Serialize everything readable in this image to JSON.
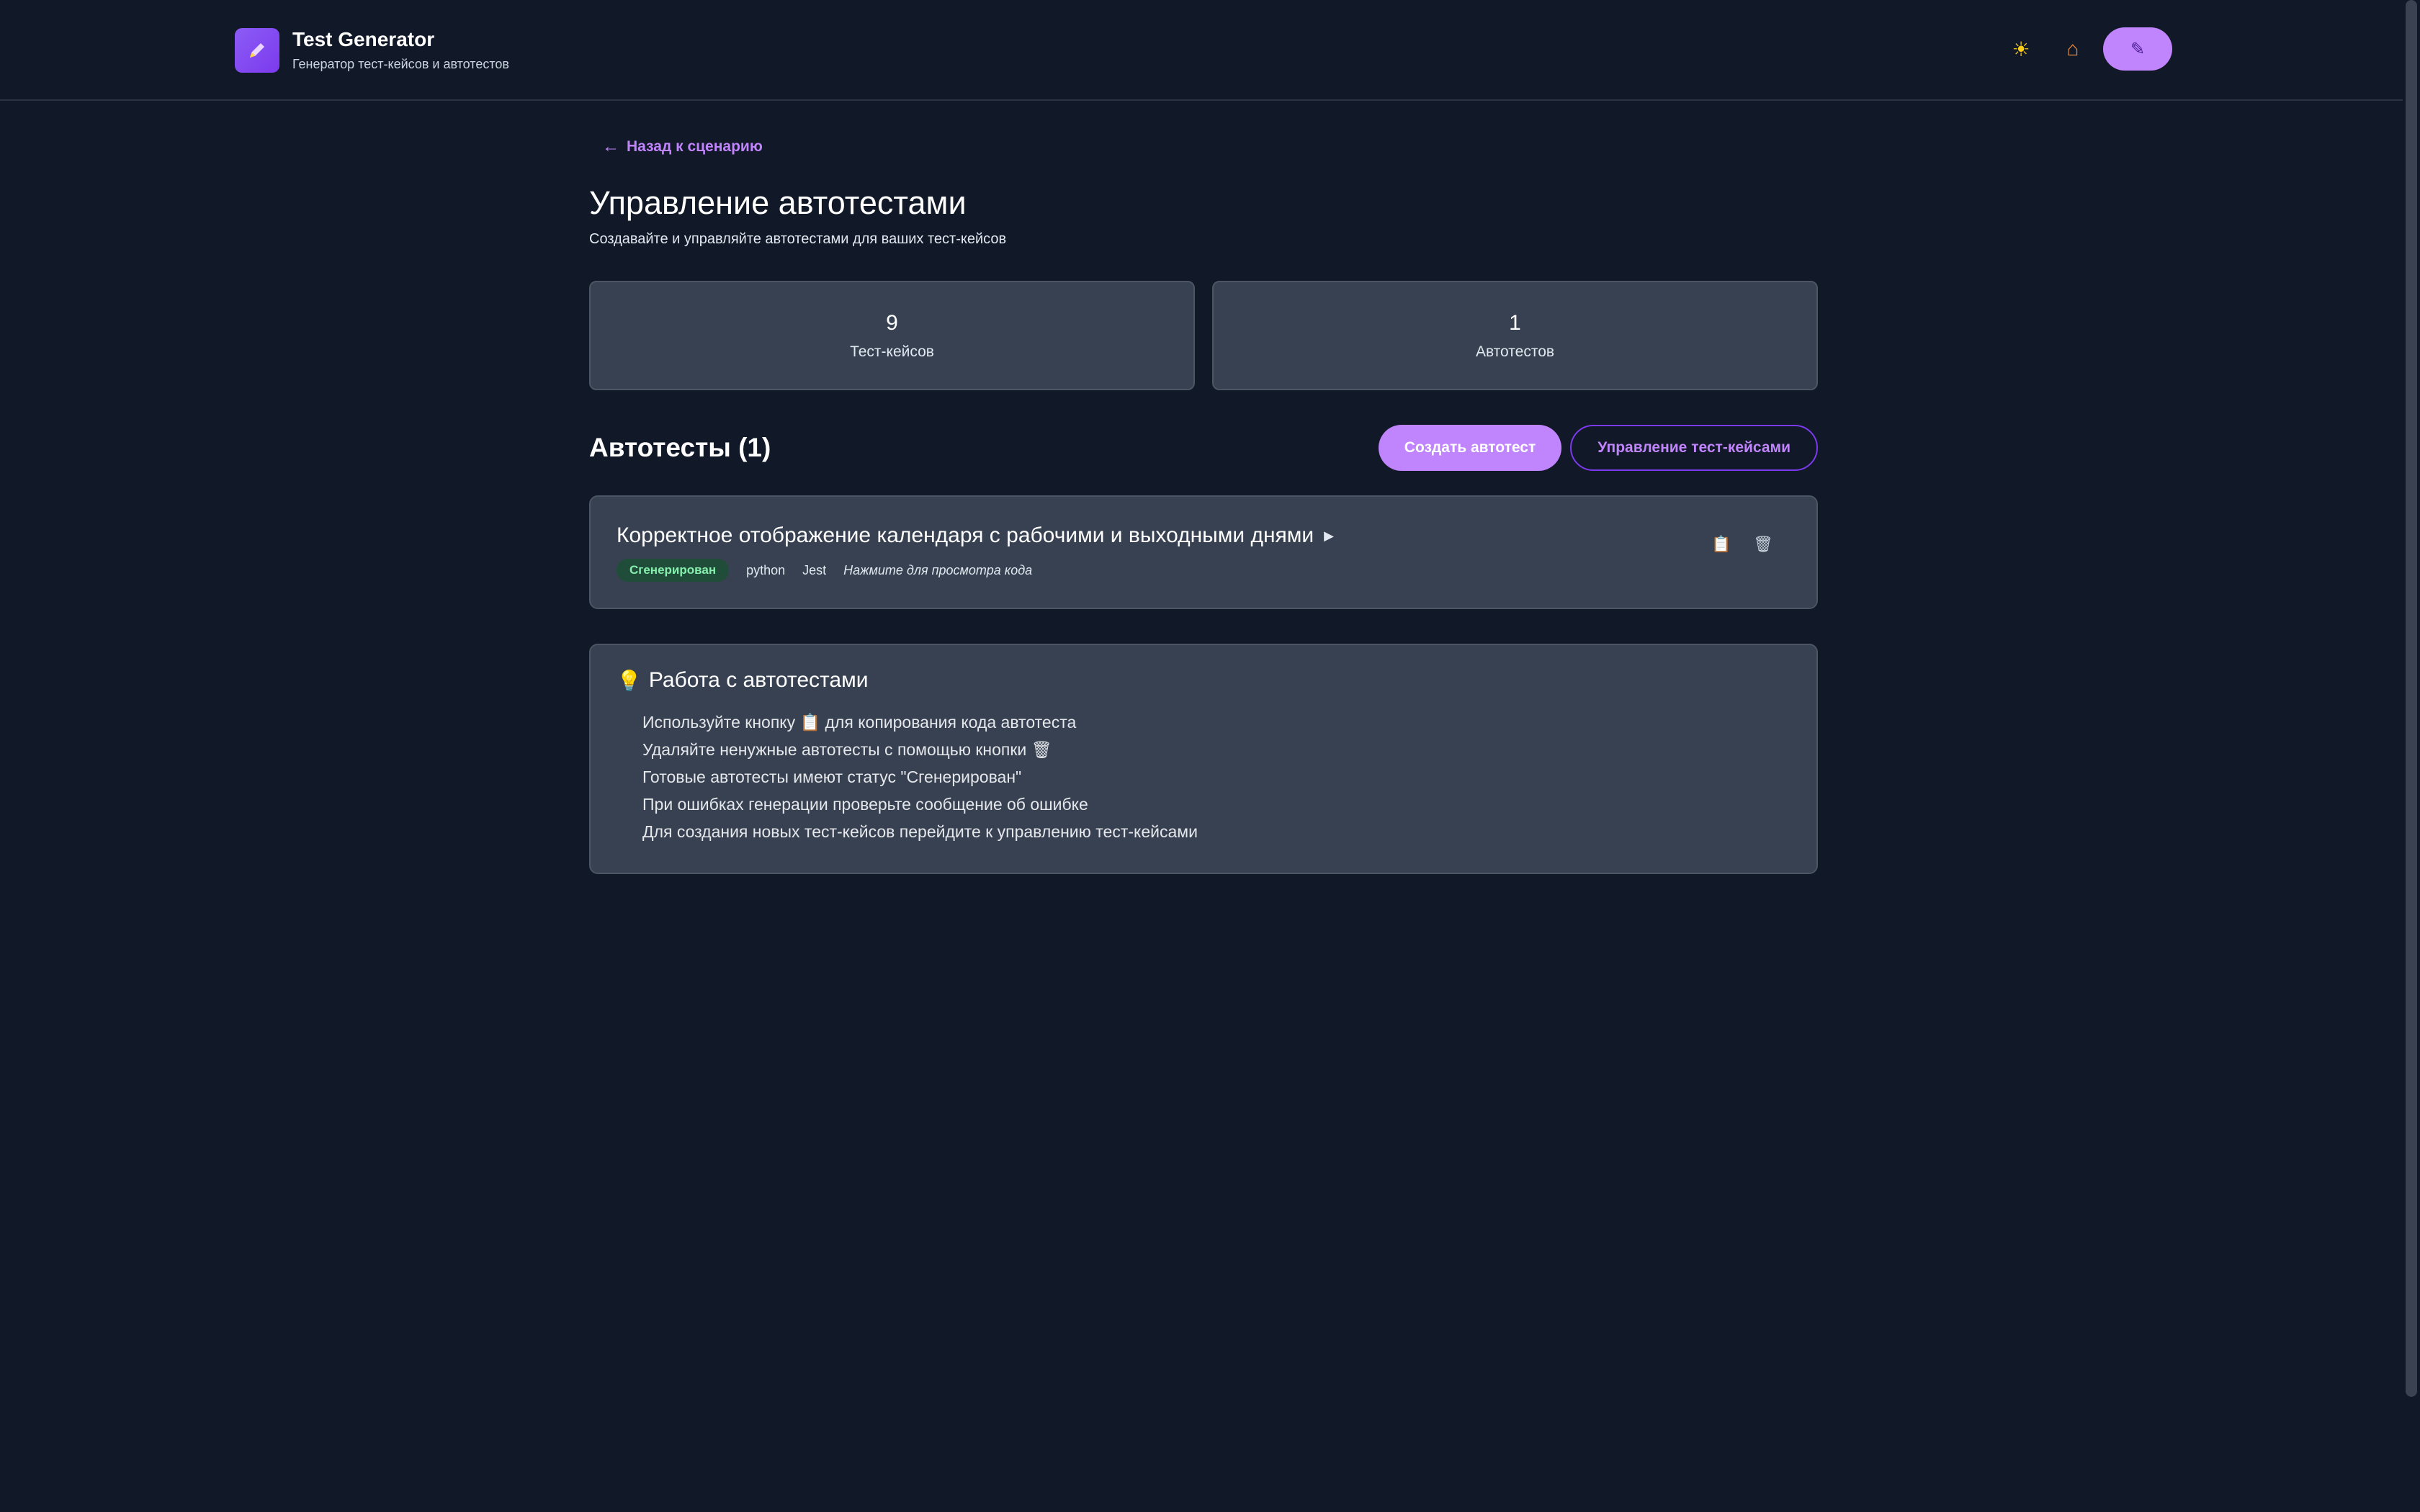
{
  "header": {
    "logo_icon": "pencil",
    "title": "Test Generator",
    "subtitle": "Генератор тест-кейсов и автотестов",
    "theme_icon": "☀",
    "home_icon": "⌂",
    "edit_icon": "✎"
  },
  "back_link": {
    "arrow": "←",
    "label": "Назад к сценарию"
  },
  "page": {
    "title": "Управление автотестами",
    "subtitle": "Создавайте и управляйте автотестами для ваших тест-кейсов"
  },
  "stats": [
    {
      "value": "9",
      "label": "Тест-кейсов"
    },
    {
      "value": "1",
      "label": "Автотестов"
    }
  ],
  "autotests_section": {
    "title": "Автотесты (1)",
    "create_button": "Создать автотест",
    "manage_button": "Управление тест-кейсами"
  },
  "autotest": {
    "title": "Корректное отображение календаря с рабочими и выходными днями",
    "play_icon": "▶",
    "status": "Сгенерирован",
    "language": "python",
    "framework": "Jest",
    "hint": "Нажмите для просмотра кода",
    "copy_icon": "📋",
    "delete_icon": "🗑"
  },
  "info": {
    "icon": "💡",
    "title": "Работа с автотестами",
    "items": [
      "Используйте кнопку 📋 для копирования кода автотеста",
      "Удаляйте ненужные автотесты с помощью кнопки 🗑",
      "Готовые автотесты имеют статус \"Сгенерирован\"",
      "При ошибках генерации проверьте сообщение об ошибке",
      "Для создания новых тест-кейсов перейдите к управлению тест-кейсами"
    ]
  }
}
